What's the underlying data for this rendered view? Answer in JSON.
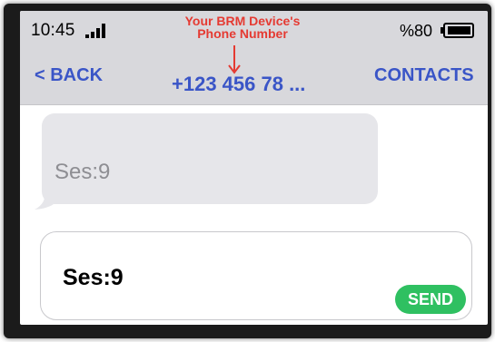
{
  "status_bar": {
    "time": "10:45",
    "signal_icon": "signal-bars-icon",
    "battery_percent": "%80",
    "battery_icon": "battery-icon"
  },
  "annotation": {
    "line1": "Your BRM Device's",
    "line2": "Phone Number",
    "color": "#e53a32"
  },
  "nav_bar": {
    "back_label": "< BACK",
    "title": "+123 456 78 ...",
    "contacts_label": "CONTACTS",
    "accent_color": "#3a55c7"
  },
  "messages": [
    {
      "text": "Ses:9",
      "direction": "incoming"
    }
  ],
  "composer": {
    "value": "Ses:9",
    "send_label": "SEND",
    "send_color": "#2fc061"
  }
}
